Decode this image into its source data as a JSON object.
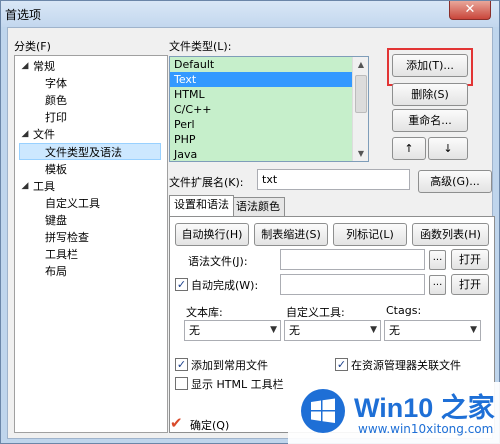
{
  "window": {
    "title": "首选项",
    "close": "✕"
  },
  "category": {
    "label": "分类(F)",
    "items": [
      {
        "label": "常规",
        "arrow": "◢"
      },
      {
        "label": "字体"
      },
      {
        "label": "颜色"
      },
      {
        "label": "打印"
      },
      {
        "label": "文件",
        "arrow": "◢"
      },
      {
        "label": "文件类型及语法"
      },
      {
        "label": "模板"
      },
      {
        "label": "工具",
        "arrow": "◢"
      },
      {
        "label": "自定义工具"
      },
      {
        "label": "键盘"
      },
      {
        "label": "拼写检查"
      },
      {
        "label": "工具栏"
      },
      {
        "label": "布局"
      }
    ]
  },
  "filetypes": {
    "label": "文件类型(L):",
    "items": [
      "Default",
      "Text",
      "HTML",
      "C/C++",
      "Perl",
      "PHP",
      "Java"
    ],
    "selected": "Text"
  },
  "buttons": {
    "add": "添加(T)...",
    "delete": "删除(S)",
    "rename": "重命名...",
    "up": "↑",
    "down": "↓",
    "advanced": "高级(G)..."
  },
  "extension": {
    "label": "文件扩展名(K):",
    "value": "txt"
  },
  "tabs": [
    "设置和语法",
    "语法颜色"
  ],
  "panel": {
    "auto_wrap": "自动换行(H)",
    "tab_indent": "制表缩进(S)",
    "column_mark": "列标记(L)",
    "function_list": "函数列表(H)",
    "syntax_file_label": "语法文件(J):",
    "syntax_file_value": "",
    "browse": "...",
    "open": "打开",
    "autocomplete_label": "自动完成(W):",
    "autocomplete_value": "",
    "text_lib_label": "文本库:",
    "custom_tool_label": "自定义工具:",
    "ctags_label": "Ctags:",
    "none": "无",
    "add_common": "添加到常用文件",
    "show_html": "显示 HTML 工具栏",
    "explorer_assoc": "在资源管理器关联文件"
  },
  "footer": {
    "ok": "确定(Q)"
  },
  "watermark": {
    "big": "Win10 之家",
    "small": "www.win10xitong.com"
  }
}
